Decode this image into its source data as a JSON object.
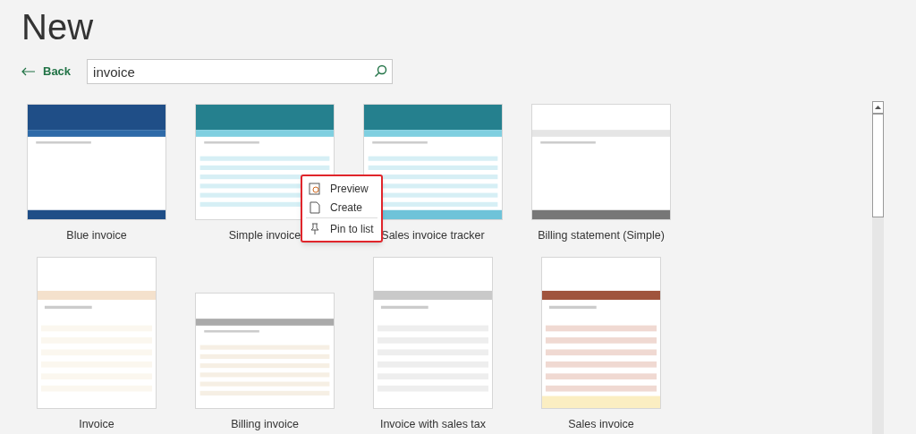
{
  "title": "New",
  "back": {
    "label": "Back"
  },
  "search": {
    "value": "invoice"
  },
  "templates": [
    {
      "name": "Blue invoice"
    },
    {
      "name": "Simple invoice"
    },
    {
      "name": "Sales invoice tracker"
    },
    {
      "name": "Billing statement (Simple)"
    },
    {
      "name": "Invoice"
    },
    {
      "name": "Billing invoice"
    },
    {
      "name": "Invoice with sales tax"
    },
    {
      "name": "Sales invoice"
    }
  ],
  "context_menu": {
    "items": [
      {
        "label": "Preview",
        "kind": "preview"
      },
      {
        "label": "Create",
        "kind": "create"
      },
      {
        "label": "Pin to list",
        "kind": "pin"
      }
    ]
  }
}
